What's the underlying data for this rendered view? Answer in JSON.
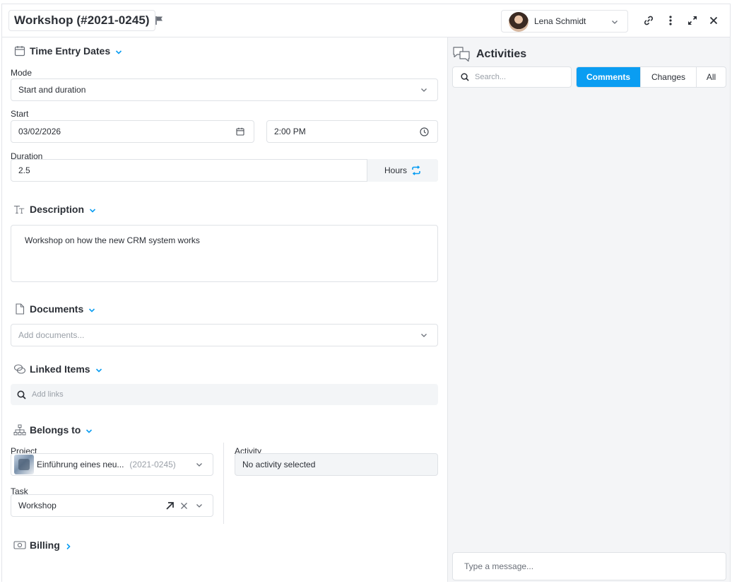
{
  "header": {
    "title": "Workshop (#2021-0245)",
    "user": "Lena Schmidt"
  },
  "time_entry": {
    "section_title": "Time Entry Dates",
    "mode_label": "Mode",
    "mode_value": "Start and duration",
    "start_label": "Start",
    "start_date": "03/02/2026",
    "start_time": "2:00 PM",
    "duration_label": "Duration",
    "duration_value": "2.5",
    "duration_unit": "Hours"
  },
  "description": {
    "section_title": "Description",
    "text": "Workshop on how the new CRM system works"
  },
  "documents": {
    "section_title": "Documents",
    "placeholder": "Add documents..."
  },
  "linked_items": {
    "section_title": "Linked Items",
    "placeholder": "Add links"
  },
  "belongs_to": {
    "section_title": "Belongs to",
    "project_label": "Project",
    "project_name": "Einführung eines neu...",
    "project_id": "(2021-0245)",
    "activity_label": "Activity",
    "activity_value": "No activity selected",
    "task_label": "Task",
    "task_value": "Workshop"
  },
  "billing": {
    "section_title": "Billing"
  },
  "activities": {
    "title": "Activities",
    "search_placeholder": "Search...",
    "tabs": [
      {
        "label": "Comments",
        "active": true
      },
      {
        "label": "Changes",
        "active": false
      },
      {
        "label": "All",
        "active": false
      }
    ],
    "message_placeholder": "Type a message..."
  },
  "colors": {
    "accent": "#0a9df2",
    "text": "#2b2f36",
    "border": "#dfe2e6",
    "panel_bg": "#f4f5f7"
  }
}
